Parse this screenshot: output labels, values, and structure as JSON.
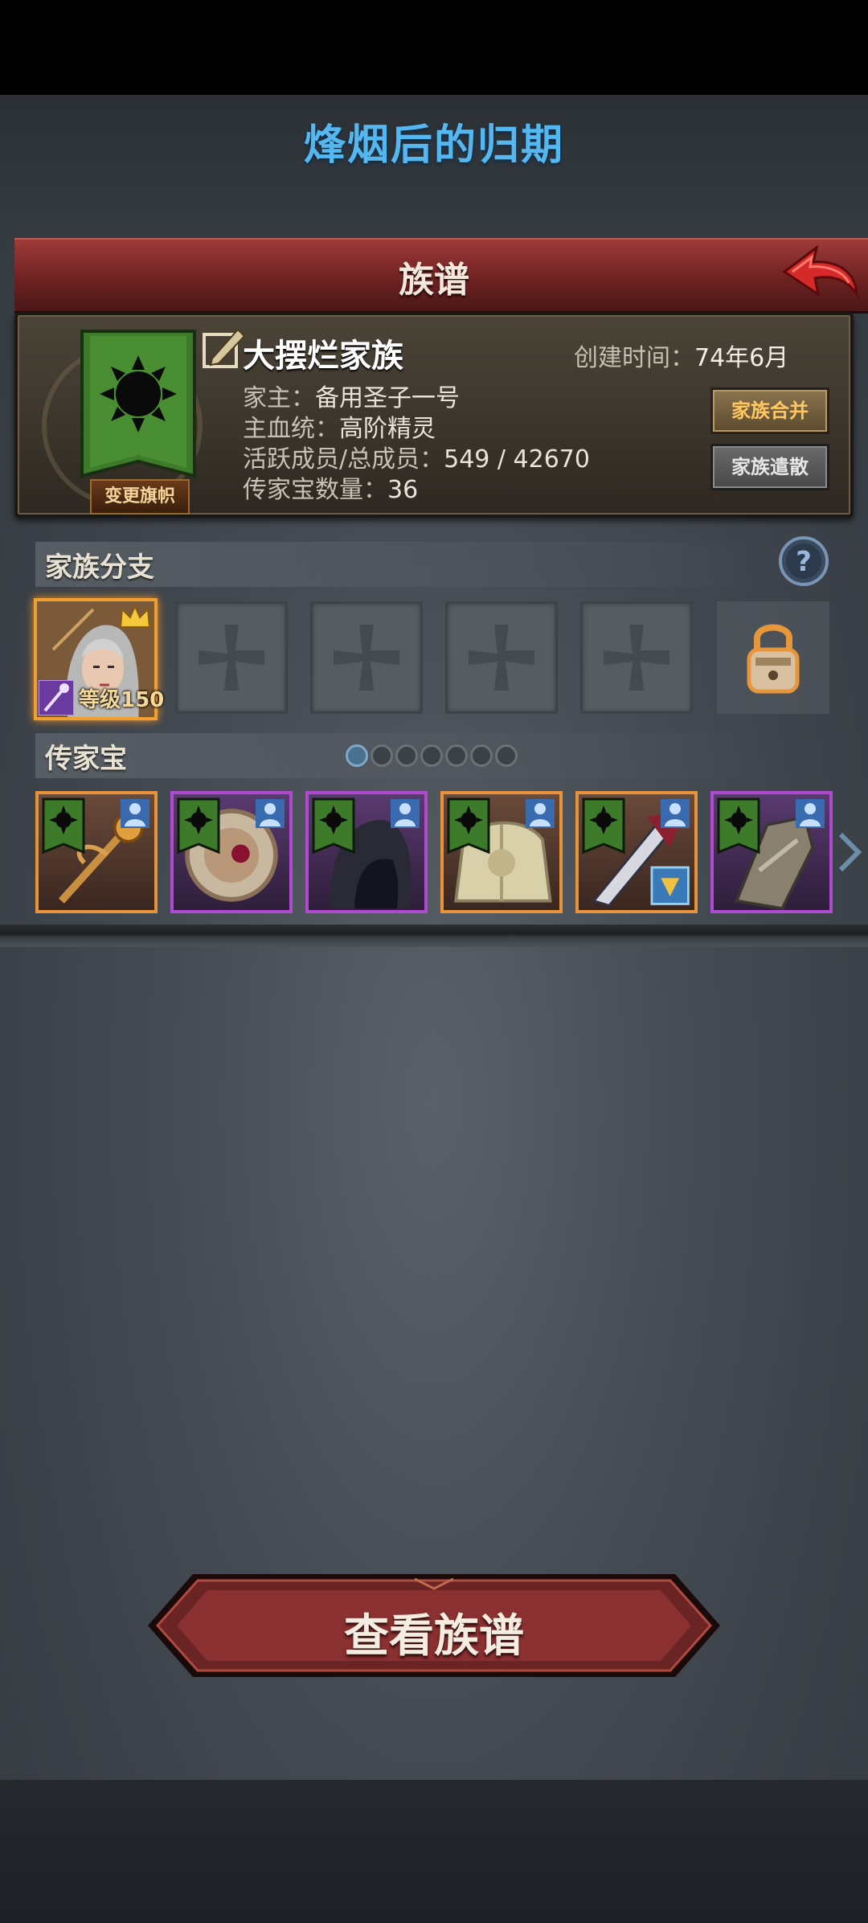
{
  "header": {
    "game_title": "烽烟后的归期",
    "panel_title": "族谱"
  },
  "family": {
    "name": "大摆烂家族",
    "created_label": "创建时间：",
    "created_value": "74年6月",
    "patriarch_label": "家主：",
    "patriarch_value": "备用圣子一号",
    "bloodline_label": "主血统：",
    "bloodline_value": "高阶精灵",
    "members_label": "活跃成员/总成员：",
    "members_value": "549 / 42670",
    "heirlooms_label": "传家宝数量：",
    "heirlooms_value": "36",
    "change_banner": "变更旗帜",
    "merge": "家族合并",
    "disband": "家族遣散"
  },
  "branches": {
    "title": "家族分支",
    "active_level": "等级150",
    "empty_slots": 4
  },
  "heirlooms": {
    "title": "传家宝",
    "page_count": 7,
    "current_page": 1,
    "items": [
      {
        "name": "staff",
        "rarity": "orange"
      },
      {
        "name": "shield",
        "rarity": "purple"
      },
      {
        "name": "hood",
        "rarity": "purple"
      },
      {
        "name": "armor",
        "rarity": "orange"
      },
      {
        "name": "blade",
        "rarity": "orange"
      },
      {
        "name": "gauntlet",
        "rarity": "purple"
      }
    ]
  },
  "footer": {
    "view_tree": "查看族谱"
  },
  "colors": {
    "title_blue": "#55b7f0",
    "header_red": "#8a2a2a",
    "orange_rarity": "#e8923a",
    "purple_rarity": "#b04ad0",
    "banner_green": "#3d7a2a"
  }
}
